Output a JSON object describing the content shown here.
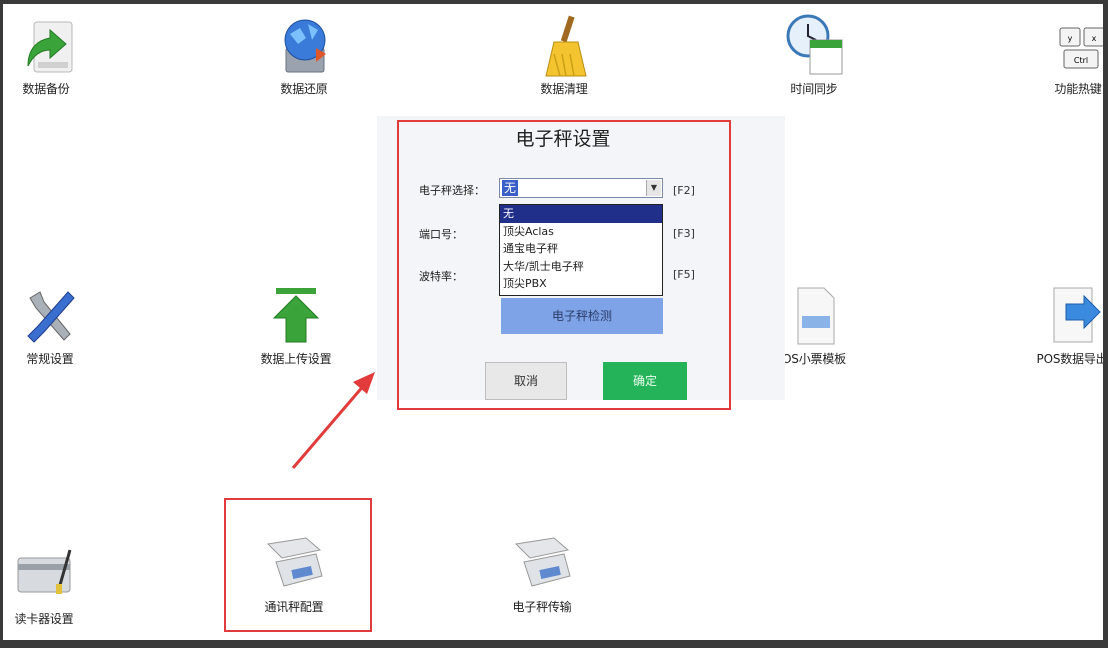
{
  "desktop": {
    "tiles": [
      {
        "label": "数据备份",
        "icon": "backup-icon"
      },
      {
        "label": "数据还原",
        "icon": "restore-icon"
      },
      {
        "label": "数据清理",
        "icon": "broom-icon"
      },
      {
        "label": "时间同步",
        "icon": "clock-calendar-icon"
      },
      {
        "label": "功能热键",
        "icon": "keyboard-shortcut-icon"
      },
      {
        "label": "常规设置",
        "icon": "tools-icon"
      },
      {
        "label": "数据上传设置",
        "icon": "upload-arrow-icon"
      },
      {
        "label": "OS小票模板",
        "icon": "receipt-template-icon"
      },
      {
        "label": "POS数据导出",
        "icon": "export-icon"
      },
      {
        "label": "读卡器设置",
        "icon": "card-reader-icon"
      },
      {
        "label": "通讯秤配置",
        "icon": "scale-icon"
      },
      {
        "label": "电子秤传输",
        "icon": "scale-icon"
      }
    ]
  },
  "dialog": {
    "title": "电子秤设置",
    "scale_label": "电子秤选择：",
    "scale_value": "无",
    "scale_key": "[F2]",
    "port_label": "端口号：",
    "port_key": "[F3]",
    "baud_label": "波特率：",
    "baud_key": "[F5]",
    "options": [
      "无",
      "顶尖Aclas",
      "通宝电子秤",
      "大华/凯士电子秤",
      "顶尖PBX"
    ],
    "detect_button": "电子秤检测",
    "cancel_button": "取消",
    "ok_button": "确定"
  },
  "colors": {
    "highlight": "#e23b3b",
    "ok_green": "#25b35a",
    "detect_blue": "#7ea3e6",
    "selected_option": "#1f2f8a"
  }
}
